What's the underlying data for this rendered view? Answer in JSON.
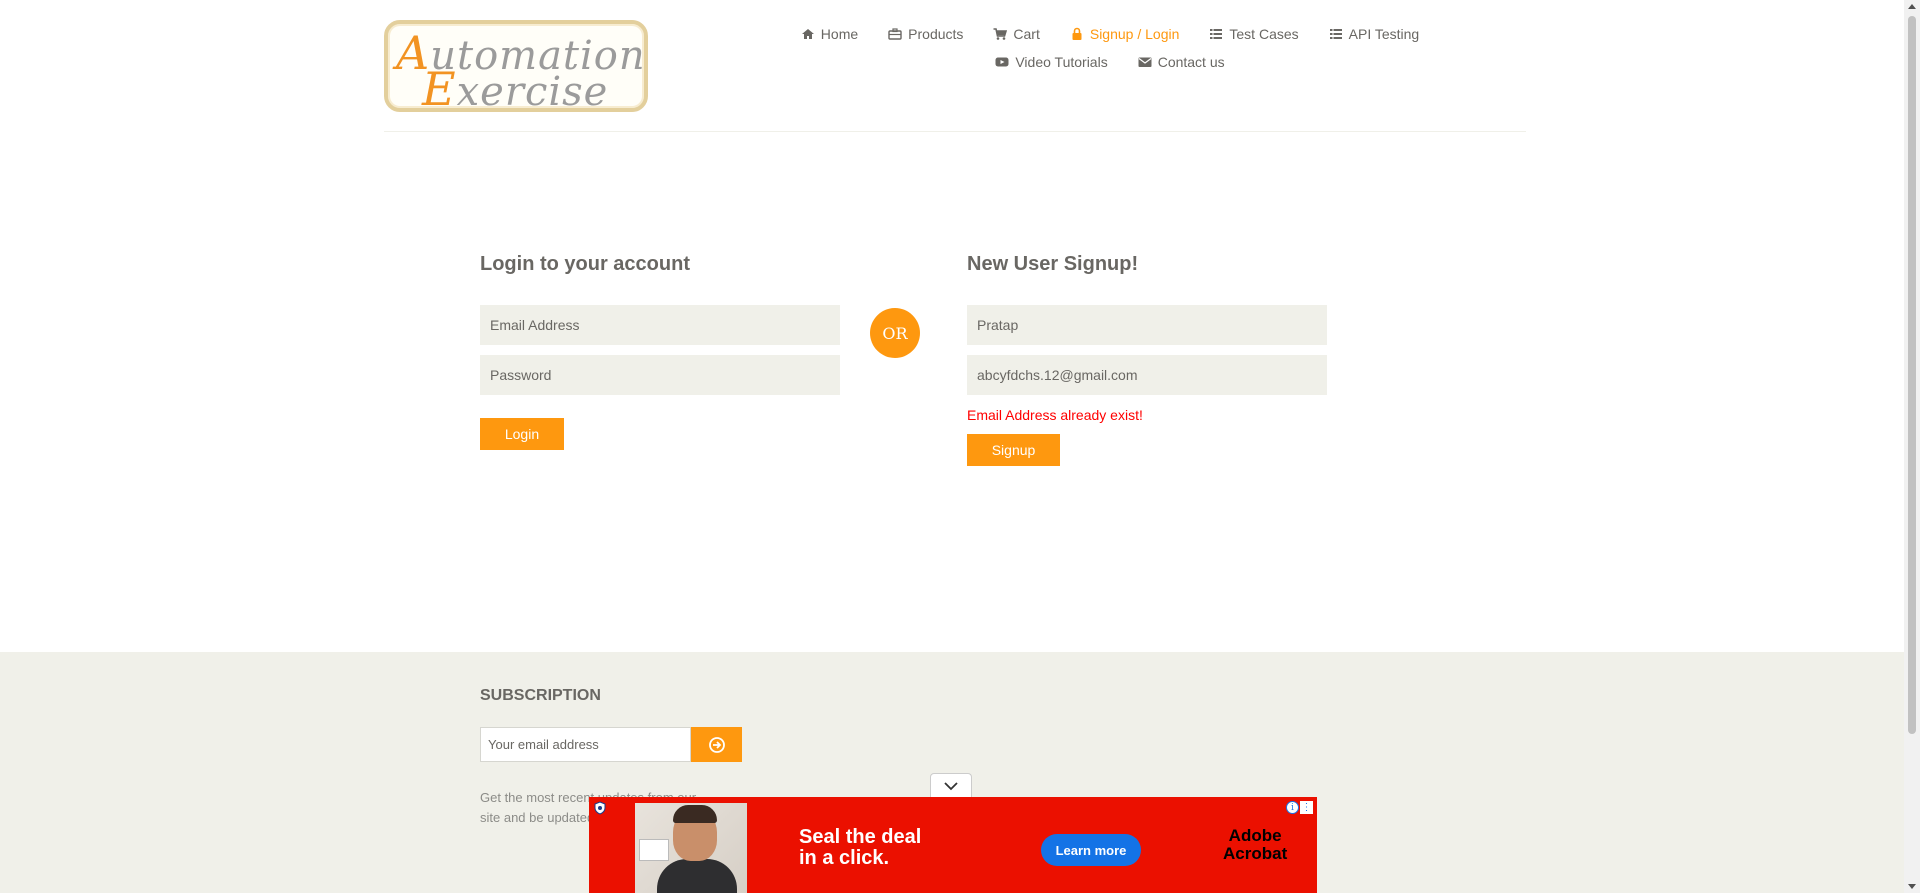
{
  "header": {
    "logo": {
      "line1": "Automation",
      "line2": "Exercise"
    },
    "nav": [
      {
        "label": "Home",
        "icon": "home-icon",
        "active": false
      },
      {
        "label": "Products",
        "icon": "briefcase-icon",
        "active": false
      },
      {
        "label": "Cart",
        "icon": "cart-icon",
        "active": false
      },
      {
        "label": "Signup / Login",
        "icon": "lock-icon",
        "active": true
      },
      {
        "label": "Test Cases",
        "icon": "list-icon",
        "active": false
      },
      {
        "label": "API Testing",
        "icon": "list-icon",
        "active": false
      },
      {
        "label": "Video Tutorials",
        "icon": "youtube-icon",
        "active": false
      },
      {
        "label": "Contact us",
        "icon": "envelope-icon",
        "active": false
      }
    ]
  },
  "login": {
    "title": "Login to your account",
    "email_placeholder": "Email Address",
    "password_placeholder": "Password",
    "button_label": "Login"
  },
  "or_label": "OR",
  "signup": {
    "title": "New User Signup!",
    "name_value": "Pratap",
    "email_value": "abcyfdchs.12@gmail.com",
    "error": "Email Address already exist!",
    "button_label": "Signup"
  },
  "footer": {
    "subscription_title": "SUBSCRIPTION",
    "email_placeholder": "Your email address",
    "description": "Get the most recent updates from our site and be updated your self..."
  },
  "ad": {
    "headline_line1": "Seal the deal",
    "headline_line2": "in a click.",
    "cta_label": "Learn more",
    "brand_line1": "Adobe",
    "brand_line2": "Acrobat"
  },
  "colors": {
    "accent": "#fe980f",
    "error": "#ff0000",
    "ad_background": "#eb1000",
    "ad_button": "#1473e6"
  }
}
